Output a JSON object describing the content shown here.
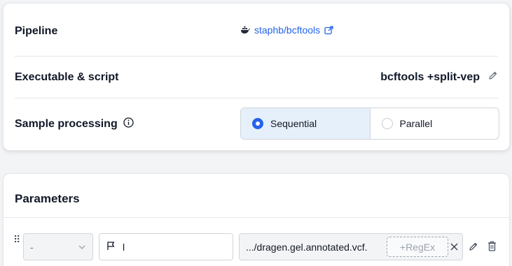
{
  "settings": {
    "pipeline_label": "Pipeline",
    "pipeline_value": "staphb/bcftools",
    "pipeline_icon": "docker-whale-icon",
    "external_link_icon": "external-link-icon",
    "exec_label": "Executable & script",
    "exec_value": "bcftools +split-vep",
    "edit_icon": "pencil-icon",
    "sample_label": "Sample processing",
    "info_icon": "info-icon",
    "processing_options": [
      {
        "label": "Sequential",
        "selected": true
      },
      {
        "label": "Parallel",
        "selected": false
      }
    ]
  },
  "parameters": {
    "title": "Parameters",
    "rows": [
      {
        "type_value": "-",
        "flag_value": "l",
        "value_text": ".../dragen.gel.annotated.vcf.",
        "regex_label": "+RegEx"
      }
    ]
  },
  "colors": {
    "accent": "#2563eb",
    "selected_bg": "#e6f0fb",
    "border": "#d1d5db"
  }
}
